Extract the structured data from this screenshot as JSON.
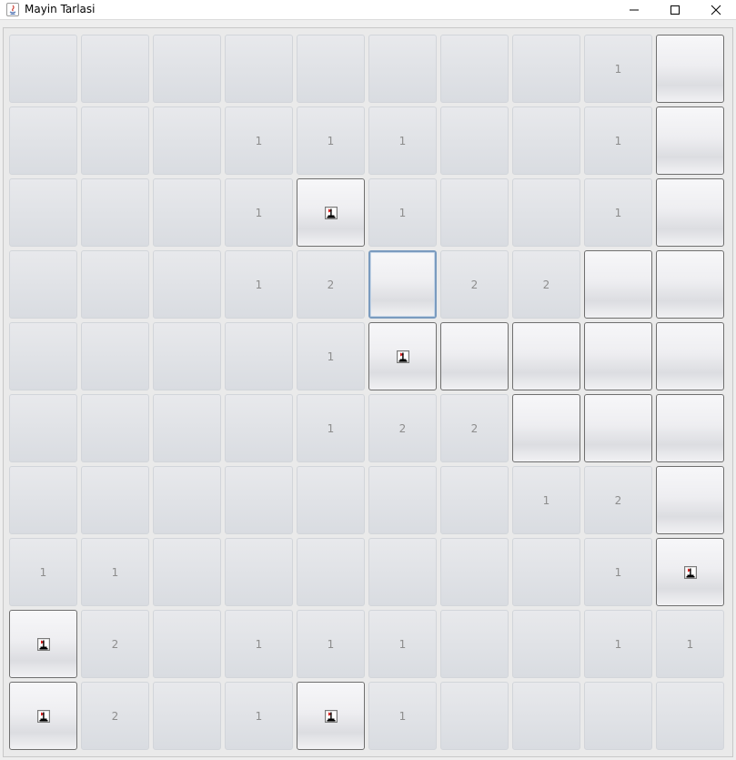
{
  "window": {
    "title": "Mayin Tarlasi",
    "app_icon": "java-icon",
    "controls": [
      "minimize-icon",
      "maximize-icon",
      "close-icon"
    ]
  },
  "board": {
    "rows": 10,
    "cols": 10,
    "legend": {
      "R": "revealed empty",
      "C": "covered",
      "F": "covered flagged",
      "X": "covered focused",
      "1-8": "revealed number"
    },
    "cells": [
      [
        "R",
        "R",
        "R",
        "R",
        "R",
        "R",
        "R",
        "R",
        "1",
        "C"
      ],
      [
        "R",
        "R",
        "R",
        "1",
        "1",
        "1",
        "R",
        "R",
        "1",
        "C"
      ],
      [
        "R",
        "R",
        "R",
        "1",
        "F",
        "1",
        "R",
        "R",
        "1",
        "C"
      ],
      [
        "R",
        "R",
        "R",
        "1",
        "2",
        "X",
        "2",
        "2",
        "C",
        "C"
      ],
      [
        "R",
        "R",
        "R",
        "R",
        "1",
        "F",
        "C",
        "C",
        "C",
        "C"
      ],
      [
        "R",
        "R",
        "R",
        "R",
        "1",
        "2",
        "2",
        "C",
        "C",
        "C"
      ],
      [
        "R",
        "R",
        "R",
        "R",
        "R",
        "R",
        "R",
        "1",
        "2",
        "C"
      ],
      [
        "1",
        "1",
        "R",
        "R",
        "R",
        "R",
        "R",
        "R",
        "1",
        "F"
      ],
      [
        "F",
        "2",
        "R",
        "1",
        "1",
        "1",
        "R",
        "R",
        "1",
        "1"
      ],
      [
        "F",
        "2",
        "R",
        "1",
        "F",
        "1",
        "R",
        "R",
        "R",
        "R"
      ]
    ],
    "flag_icon": "flag-icon",
    "colors": {
      "revealed": "#dadde2",
      "covered_border": "#6f6f6f",
      "number_text": "#8d8d8d",
      "focus_border": "#7a9bbf",
      "flag_red": "#d01a1a"
    }
  }
}
